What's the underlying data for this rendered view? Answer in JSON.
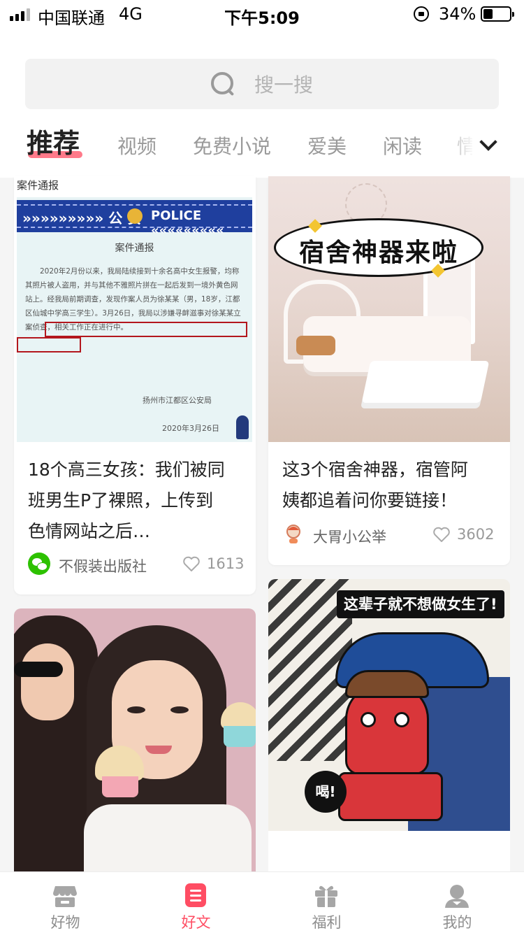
{
  "status_bar": {
    "carrier": "中国联通",
    "network": "4G",
    "time": "下午5:09",
    "battery": "34%"
  },
  "search": {
    "placeholder": "搜一搜"
  },
  "tabs": [
    {
      "label": "推荐",
      "active": true
    },
    {
      "label": "视频"
    },
    {
      "label": "免费小说"
    },
    {
      "label": "爱美"
    },
    {
      "label": "闲读"
    },
    {
      "label": "情"
    }
  ],
  "cards": [
    {
      "title": "18个高三女孩：我们被同班男生P了裸照，上传到色情网站之后…",
      "title_lines": [
        "18个高三女孩：我们被同",
        "班男生P了裸照，上传到",
        "色情网站之后…"
      ],
      "author": "不假装出版社",
      "likes": "1613",
      "image": {
        "source_label": "案件通报",
        "banner_left": "»»»»»»»»» 公 安",
        "banner_right": "POLICE «««««««««",
        "heading": "案件通报",
        "body": "2020年2月份以来，我局陆续接到十余名高中女生报警，均称其照片被人盗用，并与其他不雅照片拼在一起后发到一境外黄色网站上。经我局前期调查，发现作案人员为徐某某（男，18岁，江都区仙城中学高三学生）。3月26日，我局以涉嫌寻衅滋事对徐某某立案侦查，相关工作正在进行中。",
        "signature": "扬州市江都区公安局",
        "date": "2020年3月26日"
      }
    },
    {
      "title": "这3个宿舍神器，宿管阿姨都追着问你要链接！",
      "title_lines": [
        "这3个宿舍神器，宿管阿",
        "姨都追着问你要链接！"
      ],
      "author": "大胃小公举",
      "likes": "3602",
      "image": {
        "bubble_text": "宿舍神器来啦"
      }
    },
    {
      "image": {
        "caption": "这辈子就不想做女生了!",
        "shout": "喝!"
      }
    }
  ],
  "bottom_nav": [
    {
      "label": "好物",
      "icon": "shop-icon"
    },
    {
      "label": "好文",
      "icon": "article-icon",
      "active": true
    },
    {
      "label": "福利",
      "icon": "gift-icon"
    },
    {
      "label": "我的",
      "icon": "profile-icon"
    }
  ],
  "colors": {
    "accent": "#ff4d63",
    "tab_underline": "#ff6b7d",
    "wechat_green": "#2dc100"
  }
}
